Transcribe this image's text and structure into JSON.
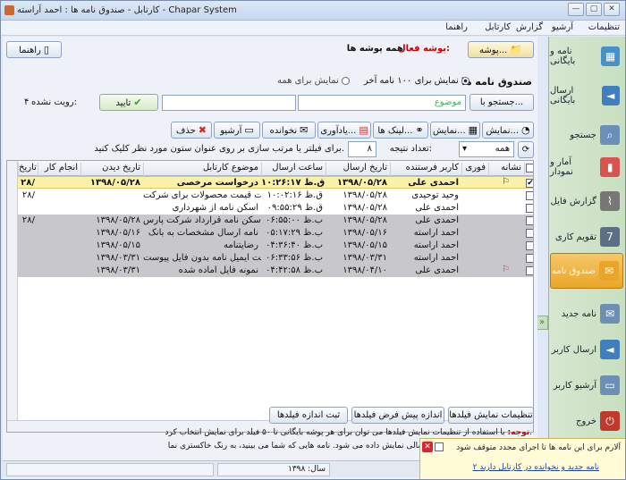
{
  "window": {
    "title": "کارتابل - صندوق نامه ها : احمد آراسته - Chapar System"
  },
  "menubar": {
    "items": [
      "تنظیمات",
      "آرشیو",
      "گزارش",
      "کارتابل",
      "راهنما"
    ]
  },
  "sidebar": {
    "items": [
      {
        "label": "نامه و بایگانی",
        "icon": "letters-archive-icon",
        "color": "#4a90c8"
      },
      {
        "label": "ارسال بایگانی",
        "icon": "send-archive-icon",
        "color": "#3f7fbf"
      },
      {
        "label": "جستجو",
        "icon": "search-icon",
        "color": "#6a8fb8"
      },
      {
        "label": "آمار و نمودار",
        "icon": "chart-icon",
        "color": "#d9534f"
      },
      {
        "label": "گزارش فایل",
        "icon": "paperclip-icon",
        "color": "#777777"
      },
      {
        "label": "تقویم کاری",
        "icon": "calendar-icon",
        "color": "#5b6f86"
      },
      {
        "label": "صندوق نامه",
        "icon": "inbox-icon",
        "color": "#e8a52a"
      },
      {
        "label": "نامه جدید",
        "icon": "new-letter-icon",
        "color": "#6d8fb5"
      },
      {
        "label": "ارسال کاربر",
        "icon": "send-user-icon",
        "color": "#3f7fbf"
      },
      {
        "label": "آرشیو کاربر",
        "icon": "user-archive-icon",
        "color": "#6d8fb5"
      },
      {
        "label": "خروج",
        "icon": "exit-icon",
        "color": "#c0392b"
      }
    ]
  },
  "folderbar": {
    "help_label": "راهنما",
    "active_folder_prefix": "پوشه فعال:",
    "active_folder": "همه پوشه ها",
    "folder_button": "پوشه..."
  },
  "options": {
    "title": "صندوق نامه ها",
    "radio_last100": "نمایش برای ۱۰۰ نامه آخر",
    "radio_all": "نمایش برای همه"
  },
  "search": {
    "button": "جستجو با...",
    "field_value": "موضوع",
    "confirm": "تایید",
    "unseen_label": "رویت نشده:",
    "unseen_count": "۴"
  },
  "actions": [
    "نمایش...",
    "نمایش...",
    "لینک ها...",
    "یادآوری...",
    "نخوانده",
    "آرشیو",
    "حذف"
  ],
  "filter": {
    "select_value": "همه",
    "count_label": "تعداد نتیجه:",
    "count_value": "۸",
    "hint": "برای فیلتر یا مرتب سازی بر روی عنوان ستون مورد نظر کلیک کنید."
  },
  "table": {
    "columns": [
      "نشانه",
      "فوری",
      "کاربر فرستنده",
      "تاریخ ارسال",
      "ساعت ارسال",
      "موضوع کارتابل",
      "تاریخ دیدن",
      "انجام کار",
      "تاریخ"
    ],
    "rows": [
      {
        "style": "sel",
        "checked": true,
        "flag": "flag",
        "sender": "احمدی علی",
        "date": "۱۳۹۸/۰۵/۲۸",
        "time": "۱۰:۲۶:۱۷ ق.ظ",
        "subject": "درخواست مرخصی",
        "seen": "۱۳۹۸/۰۵/۲۸",
        "task": "",
        "extra": "۲۸/"
      },
      {
        "style": "white",
        "checked": false,
        "flag": "",
        "sender": "وحید توحیدی",
        "date": "۱۳۹۸/۰۵/۲۸",
        "time": "۱۰:۰۲:۱۶ ق.ظ",
        "subject": "لیست قیمت محصولات برای شرکت",
        "seen": "",
        "task": "",
        "extra": "۲۸/"
      },
      {
        "style": "white",
        "checked": false,
        "flag": "",
        "sender": "احمدی علی",
        "date": "۱۳۹۸/۰۵/۲۸",
        "time": "۰۹:۵۵:۲۹ ق.ظ",
        "subject": "اسکن نامه از شهرداری",
        "seen": "",
        "task": "",
        "extra": ""
      },
      {
        "style": "grey",
        "checked": false,
        "flag": "",
        "sender": "احمدی علی",
        "date": "۱۳۹۸/۰۵/۲۸",
        "time": "۰۶:۵۵:۰۰ ب.ظ",
        "subject": "اسکن نامه قرارداد شرکت پارس",
        "seen": "۱۳۹۸/۰۵/۲۸",
        "task": "",
        "extra": "۲۸/"
      },
      {
        "style": "grey",
        "checked": false,
        "flag": "",
        "sender": "احمد آراسته",
        "date": "۱۳۹۸/۰۵/۱۶",
        "time": "۰۵:۱۷:۲۹ ب.ظ",
        "subject": "نامه ارسال مشخصات به بانک",
        "seen": "۱۳۹۸/۰۵/۱۶",
        "task": "",
        "extra": ""
      },
      {
        "style": "grey",
        "checked": false,
        "flag": "",
        "sender": "احمد آراسته",
        "date": "۱۳۹۸/۰۵/۱۵",
        "time": "۰۴:۳۶:۴۰ ب.ظ",
        "subject": "رضایتنامه",
        "seen": "۱۳۹۸/۰۵/۱۵",
        "task": "",
        "extra": ""
      },
      {
        "style": "grey",
        "checked": false,
        "flag": "",
        "sender": "احمد آراسته",
        "date": "۱۳۹۸/۰۳/۳۱",
        "time": "۰۶:۳۳:۵۶ ب.ظ",
        "subject": "تست ایمیل نامه بدون فایل پیوست",
        "seen": "۱۳۹۸/۰۳/۳۱",
        "task": "",
        "extra": ""
      },
      {
        "style": "grey",
        "checked": false,
        "flag": "flag-red",
        "sender": "احمدی علی",
        "date": "۱۳۹۸/۰۴/۱۰",
        "time": "۰۴:۴۲:۵۸ ب.ظ",
        "subject": "نمونه فایل آماده شده",
        "seen": "۱۳۹۸/۰۳/۳۱",
        "task": "",
        "extra": ""
      }
    ]
  },
  "bottombuttons": [
    "تنظیمات نمایش فیلدها",
    "اندازه پیش فرض فیلدها",
    "ثبت اندازه فیلدها"
  ],
  "notice": {
    "line1_prefix": "توجه:",
    "line1": " با استفاده از تنظیمات نمایش فیلدها می توان برای هر پوشه بایگانی تا ۵۰ فیلد برای نمایش انتخاب کرد.",
    "line2": "در ردیف نامه، مشخصات نامه ارسالی نمایش داده می شود. نامه هایی که شما می بینید، به رنگ خاکستری نما"
  },
  "status": {
    "year_label": "سال: ۱۳۹۸"
  },
  "popup": {
    "alarm": "آلارم برای این نامه ها تا اجرای مجدد متوقف شود",
    "link": "۲ نامه جدید و نخوانده در کارتابل دارید"
  }
}
